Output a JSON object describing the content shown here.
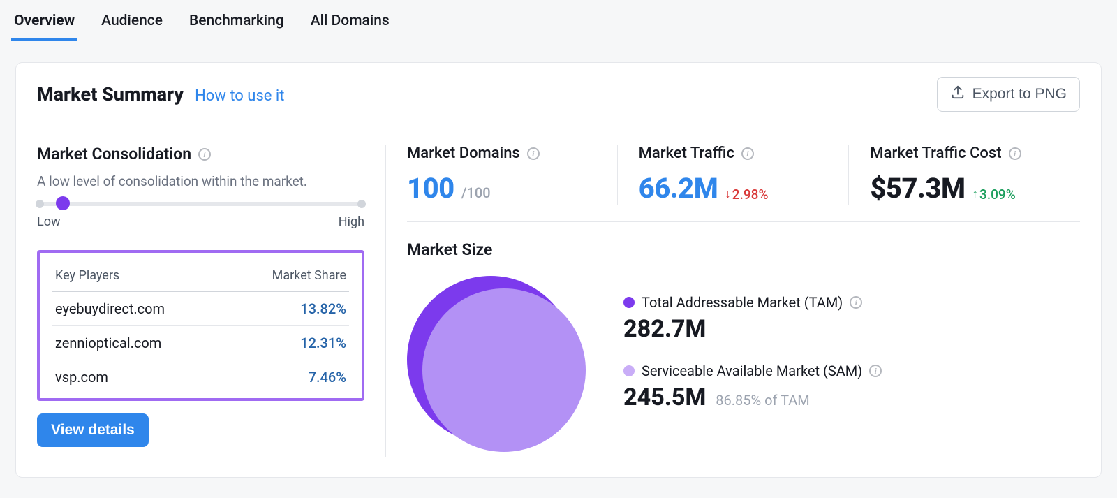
{
  "tabs": {
    "overview": "Overview",
    "audience": "Audience",
    "benchmarking": "Benchmarking",
    "all_domains": "All Domains"
  },
  "header": {
    "title": "Market Summary",
    "howto": "How to use it",
    "export": "Export to PNG"
  },
  "consolidation": {
    "title": "Market Consolidation",
    "desc": "A low level of consolidation within the market.",
    "low_label": "Low",
    "high_label": "High"
  },
  "players": {
    "col_players": "Key Players",
    "col_share": "Market Share",
    "rows": [
      {
        "domain": "eyebuydirect.com",
        "share": "13.82%"
      },
      {
        "domain": "zennioptical.com",
        "share": "12.31%"
      },
      {
        "domain": "vsp.com",
        "share": "7.46%"
      }
    ],
    "view_details": "View details"
  },
  "metrics": {
    "domains": {
      "title": "Market Domains",
      "value": "100",
      "suffix": "/100"
    },
    "traffic": {
      "title": "Market Traffic",
      "value": "66.2M",
      "delta": "2.98%"
    },
    "cost": {
      "title": "Market Traffic Cost",
      "value": "$57.3M",
      "delta": "3.09%"
    }
  },
  "market_size": {
    "title": "Market Size",
    "tam": {
      "label": "Total Addressable Market (TAM)",
      "value": "282.7M"
    },
    "sam": {
      "label": "Serviceable Available Market (SAM)",
      "value": "245.5M",
      "pct": "86.85% of TAM"
    }
  },
  "chart_data": {
    "type": "pie",
    "title": "Market Size",
    "series": [
      {
        "name": "Total Addressable Market (TAM)",
        "value": 282.7,
        "unit": "M",
        "color": "#7c3aed"
      },
      {
        "name": "Serviceable Available Market (SAM)",
        "value": 245.5,
        "unit": "M",
        "pct_of_tam": 86.85,
        "color": "#b391f5"
      }
    ]
  }
}
